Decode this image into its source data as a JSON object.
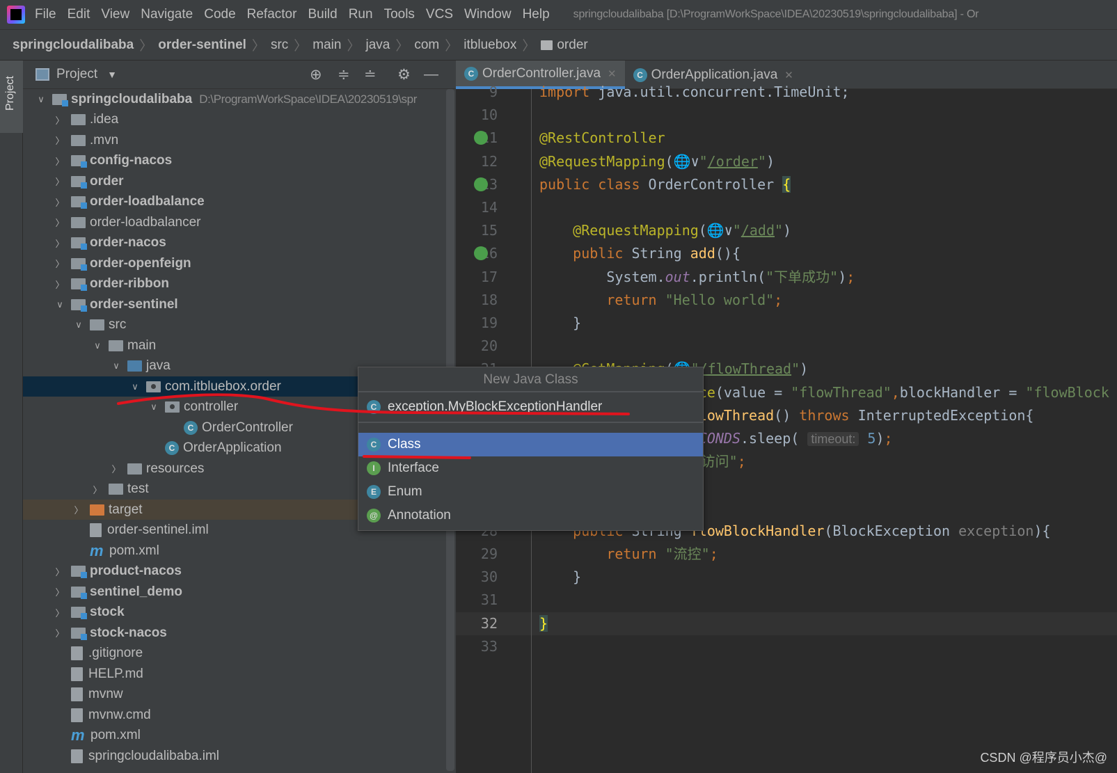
{
  "menu": {
    "items": [
      "File",
      "Edit",
      "View",
      "Navigate",
      "Code",
      "Refactor",
      "Build",
      "Run",
      "Tools",
      "VCS",
      "Window",
      "Help"
    ],
    "window_title": "springcloudalibaba [D:\\ProgramWorkSpace\\IDEA\\20230519\\springcloudalibaba] - Or"
  },
  "breadcrumb": [
    {
      "label": "springcloudalibaba",
      "bold": true
    },
    {
      "label": "order-sentinel",
      "bold": true
    },
    {
      "label": "src"
    },
    {
      "label": "main"
    },
    {
      "label": "java"
    },
    {
      "label": "com"
    },
    {
      "label": "itbluebox"
    },
    {
      "label": "order",
      "folder": true
    }
  ],
  "sidestrip": {
    "label": "Project"
  },
  "project": {
    "title": "Project",
    "tools": [
      "locate-icon",
      "expand-all-icon",
      "collapse-all-icon",
      "gear-icon",
      "minimize-icon"
    ],
    "tree": [
      {
        "label": "springcloudalibaba",
        "path": "D:\\ProgramWorkSpace\\IDEA\\20230519\\spr",
        "indent": 0,
        "chev": "open",
        "icon": "mod",
        "bold": true
      },
      {
        "label": ".idea",
        "indent": 1,
        "chev": "closed",
        "icon": "folder"
      },
      {
        "label": ".mvn",
        "indent": 1,
        "chev": "closed",
        "icon": "folder"
      },
      {
        "label": "config-nacos",
        "indent": 1,
        "chev": "closed",
        "icon": "mod",
        "bold": true
      },
      {
        "label": "order",
        "indent": 1,
        "chev": "closed",
        "icon": "mod",
        "bold": true
      },
      {
        "label": "order-loadbalance",
        "indent": 1,
        "chev": "closed",
        "icon": "mod",
        "bold": true
      },
      {
        "label": "order-loadbalancer",
        "indent": 1,
        "chev": "closed",
        "icon": "folder"
      },
      {
        "label": "order-nacos",
        "indent": 1,
        "chev": "closed",
        "icon": "mod",
        "bold": true
      },
      {
        "label": "order-openfeign",
        "indent": 1,
        "chev": "closed",
        "icon": "mod",
        "bold": true
      },
      {
        "label": "order-ribbon",
        "indent": 1,
        "chev": "closed",
        "icon": "mod",
        "bold": true
      },
      {
        "label": "order-sentinel",
        "indent": 1,
        "chev": "open",
        "icon": "mod",
        "bold": true
      },
      {
        "label": "src",
        "indent": 2,
        "chev": "open",
        "icon": "folder"
      },
      {
        "label": "main",
        "indent": 3,
        "chev": "open",
        "icon": "folder"
      },
      {
        "label": "java",
        "indent": 4,
        "chev": "open",
        "icon": "src"
      },
      {
        "label": "com.itbluebox.order",
        "indent": 5,
        "chev": "open",
        "icon": "pkg",
        "selected": true
      },
      {
        "label": "controller",
        "indent": 6,
        "chev": "open",
        "icon": "pkg"
      },
      {
        "label": "OrderController",
        "indent": 7,
        "chev": "none",
        "icon": "class"
      },
      {
        "label": "OrderApplication",
        "indent": 6,
        "chev": "none",
        "icon": "class"
      },
      {
        "label": "resources",
        "indent": 4,
        "chev": "closed",
        "icon": "res"
      },
      {
        "label": "test",
        "indent": 3,
        "chev": "closed",
        "icon": "folder"
      },
      {
        "label": "target",
        "indent": 2,
        "chev": "closed",
        "icon": "tgt",
        "excluded": true
      },
      {
        "label": "order-sentinel.iml",
        "indent": 2,
        "chev": "none",
        "icon": "doc"
      },
      {
        "label": "pom.xml",
        "indent": 2,
        "chev": "none",
        "icon": "maven"
      },
      {
        "label": "product-nacos",
        "indent": 1,
        "chev": "closed",
        "icon": "mod",
        "bold": true
      },
      {
        "label": "sentinel_demo",
        "indent": 1,
        "chev": "closed",
        "icon": "mod",
        "bold": true
      },
      {
        "label": "stock",
        "indent": 1,
        "chev": "closed",
        "icon": "mod",
        "bold": true
      },
      {
        "label": "stock-nacos",
        "indent": 1,
        "chev": "closed",
        "icon": "mod",
        "bold": true
      },
      {
        "label": ".gitignore",
        "indent": 1,
        "chev": "none",
        "icon": "doc"
      },
      {
        "label": "HELP.md",
        "indent": 1,
        "chev": "none",
        "icon": "doc"
      },
      {
        "label": "mvnw",
        "indent": 1,
        "chev": "none",
        "icon": "doc"
      },
      {
        "label": "mvnw.cmd",
        "indent": 1,
        "chev": "none",
        "icon": "doc"
      },
      {
        "label": "pom.xml",
        "indent": 1,
        "chev": "none",
        "icon": "maven"
      },
      {
        "label": "springcloudalibaba.iml",
        "indent": 1,
        "chev": "none",
        "icon": "doc"
      }
    ]
  },
  "editor": {
    "tabs": [
      {
        "label": "OrderController.java",
        "active": true
      },
      {
        "label": "OrderApplication.java"
      }
    ],
    "current_line": 32,
    "lines": [
      {
        "n": 9,
        "html": "<span class='kw'>import</span> java.util.concurrent.TimeUnit;"
      },
      {
        "n": 10,
        "html": ""
      },
      {
        "n": 11,
        "html": "<span class='an'>@RestController</span>",
        "gicon": true
      },
      {
        "n": 12,
        "html": "<span class='an'>@RequestMapping</span>(&#x1F310;&#x2228;<span class='st'>\"<span class='url'>/order</span>\"</span>)"
      },
      {
        "n": 13,
        "html": "<span class='kw'>public class</span> OrderController <span style='background:#3b514d;color:#ffef28'>{</span>",
        "gicon": true
      },
      {
        "n": 14,
        "html": ""
      },
      {
        "n": 15,
        "html": "    <span class='an'>@RequestMapping</span>(&#x1F310;&#x2228;<span class='st'>\"<span class='url'>/add</span>\"</span>)"
      },
      {
        "n": 16,
        "html": "    <span class='kw'>public</span> String <span class='fn'>add</span>(){",
        "gicon": true
      },
      {
        "n": 17,
        "html": "        System.<span class='it'>out</span>.println(<span class='st'>\"下单成功\"</span>)<span class='kw'>;</span>"
      },
      {
        "n": 18,
        "html": "        <span class='kw'>return</span> <span class='st'>\"Hello world\"</span><span class='kw'>;</span>"
      },
      {
        "n": 19,
        "html": "    }"
      },
      {
        "n": 20,
        "html": ""
      },
      {
        "n": 21,
        "html": "    <span class='an'>@GetMapping</span>(&#x1F310;<span class='st'>\"<span class='url'>/flowThread</span>\"</span>)"
      },
      {
        "n": 22,
        "html": "    <span class='an'>@SentinelResource</span>(value = <span class='st'>\"flowThread\"</span><span class='kw'>,</span>blockHandler = <span class='st'>\"flowBlockHandler\"</span>)"
      },
      {
        "n": 23,
        "html": "    <span class='kw'>public</span> String <span class='fn'>flowThread</span>() <span class='kw'>throws</span> InterruptedException{"
      },
      {
        "n": 24,
        "html": "        TimeUnit.<span class='it'>SECONDS</span>.sleep( <span class='hint'>timeout:</span> <span style='color:#6897bb'>5</span>)<span class='kw'>;</span>"
      },
      {
        "n": 25,
        "html": "        <span class='kw'>return</span> <span class='st'>\"正常访问\"</span><span class='kw'>;</span>"
      },
      {
        "n": 26,
        "html": "    }"
      },
      {
        "n": 27,
        "html": ""
      },
      {
        "n": 28,
        "html": "    <span class='kw'>public</span> String <span class='fn'>flowBlockHandler</span>(BlockException <span style='color:#808080'>exception</span>){"
      },
      {
        "n": 29,
        "html": "        <span class='kw'>return</span> <span class='st'>\"流控\"</span><span class='kw'>;</span>"
      },
      {
        "n": 30,
        "html": "    }"
      },
      {
        "n": 31,
        "html": ""
      },
      {
        "n": 32,
        "html": "<span style='background:#3b514d;color:#ffef28'>}</span>"
      },
      {
        "n": 33,
        "html": ""
      }
    ]
  },
  "popup": {
    "title": "New Java Class",
    "input": "exception.MyBlockExceptionHandler",
    "options": [
      {
        "label": "Class",
        "key": "C",
        "color": "#3e86a0",
        "selected": true
      },
      {
        "label": "Interface",
        "key": "I",
        "color": "#5b9e50"
      },
      {
        "label": "Enum",
        "key": "E",
        "color": "#3e86a0"
      },
      {
        "label": "Annotation",
        "key": "@",
        "color": "#5b9e50"
      }
    ]
  },
  "annotation_color": "#e0141e",
  "watermark": "CSDN @程序员小杰@"
}
